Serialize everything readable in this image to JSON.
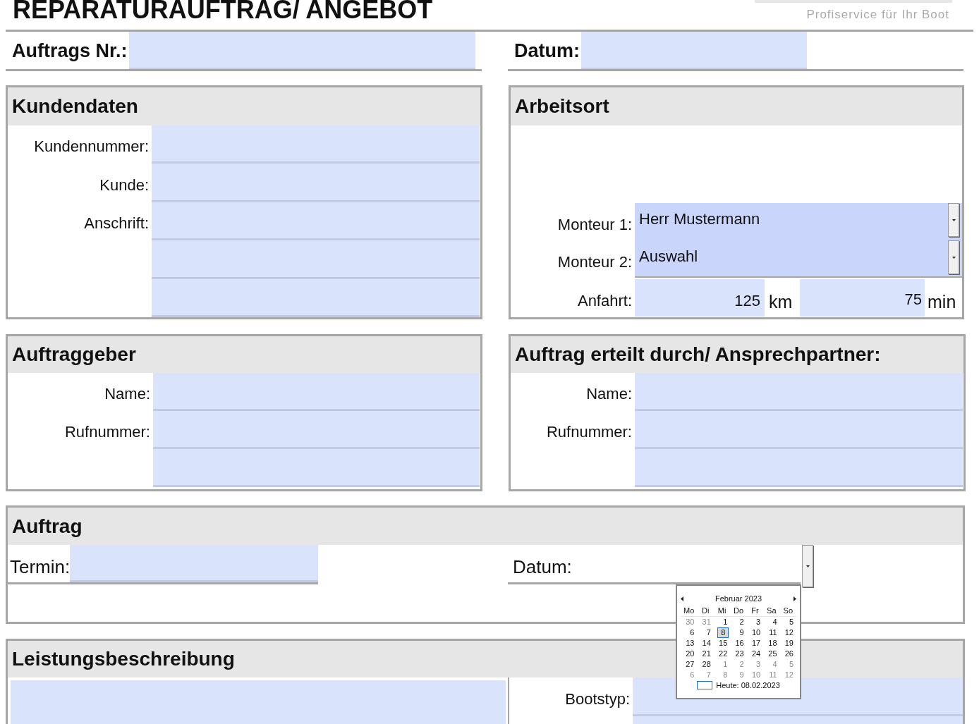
{
  "title": "REPARATURAUFTRAG/ ANGEBOT",
  "logo": {
    "tagline": "Profiservice für Ihr Boot"
  },
  "header_fields": [
    {
      "label": "Auftrags Nr.:"
    },
    {
      "label": "Datum:"
    }
  ],
  "kundendaten": {
    "title": "Kundendaten",
    "rows": [
      {
        "kind": "field",
        "label": "Kundennummer:"
      },
      {
        "kind": "field",
        "label": "Kunde:"
      },
      {
        "kind": "field",
        "label": "Anschrift:"
      },
      {
        "kind": "field"
      },
      {
        "kind": "field"
      }
    ]
  },
  "arbeitsort": {
    "title": "Arbeitsort",
    "rows": [
      {
        "kind": "dropdown",
        "label": "Monteur 1:",
        "value": "Herr Mustermann"
      },
      {
        "kind": "dropdown",
        "label": "Monteur 2:",
        "value": "Auswahl"
      },
      {
        "kind": "distance",
        "label": "Anfahrt:",
        "distance": "125",
        "distance_unit": "km",
        "time": "75",
        "time_unit": "min"
      }
    ]
  },
  "auftraggeber": {
    "title": "Auftraggeber",
    "rows": [
      {
        "kind": "field",
        "label": "Name:"
      },
      {
        "kind": "field",
        "label": "Rufnummer:"
      },
      {
        "kind": "field"
      }
    ]
  },
  "ansprechpartner": {
    "title": "Auftrag erteilt durch/ Ansprechpartner:",
    "rows": [
      {
        "kind": "field",
        "label": "Name:"
      },
      {
        "kind": "field",
        "label": "Rufnummer:"
      },
      {
        "kind": "field"
      }
    ]
  },
  "auftrag": {
    "title": "Auftrag",
    "termin_label": "Termin:",
    "datum_label": "Datum:"
  },
  "calendar": {
    "month": "Februar 2023",
    "weekdays": [
      "Mo",
      "Di",
      "Mi",
      "Do",
      "Fr",
      "Sa",
      "So"
    ],
    "weeks": [
      [
        {
          "day": "30",
          "other_month": true,
          "selected": false
        },
        {
          "day": "31",
          "other_month": true,
          "selected": false
        },
        {
          "day": "1",
          "other_month": false,
          "selected": false
        },
        {
          "day": "2",
          "other_month": false,
          "selected": false
        },
        {
          "day": "3",
          "other_month": false,
          "selected": false
        },
        {
          "day": "4",
          "other_month": false,
          "selected": false
        },
        {
          "day": "5",
          "other_month": false,
          "selected": false
        }
      ],
      [
        {
          "day": "6",
          "other_month": false,
          "selected": false
        },
        {
          "day": "7",
          "other_month": false,
          "selected": false
        },
        {
          "day": "8",
          "other_month": false,
          "selected": true
        },
        {
          "day": "9",
          "other_month": false,
          "selected": false
        },
        {
          "day": "10",
          "other_month": false,
          "selected": false
        },
        {
          "day": "11",
          "other_month": false,
          "selected": false
        },
        {
          "day": "12",
          "other_month": false,
          "selected": false
        }
      ],
      [
        {
          "day": "13",
          "other_month": false,
          "selected": false
        },
        {
          "day": "14",
          "other_month": false,
          "selected": false
        },
        {
          "day": "15",
          "other_month": false,
          "selected": false
        },
        {
          "day": "16",
          "other_month": false,
          "selected": false
        },
        {
          "day": "17",
          "other_month": false,
          "selected": false
        },
        {
          "day": "18",
          "other_month": false,
          "selected": false
        },
        {
          "day": "19",
          "other_month": false,
          "selected": false
        }
      ],
      [
        {
          "day": "20",
          "other_month": false,
          "selected": false
        },
        {
          "day": "21",
          "other_month": false,
          "selected": false
        },
        {
          "day": "22",
          "other_month": false,
          "selected": false
        },
        {
          "day": "23",
          "other_month": false,
          "selected": false
        },
        {
          "day": "24",
          "other_month": false,
          "selected": false
        },
        {
          "day": "25",
          "other_month": false,
          "selected": false
        },
        {
          "day": "26",
          "other_month": false,
          "selected": false
        }
      ],
      [
        {
          "day": "27",
          "other_month": false,
          "selected": false
        },
        {
          "day": "28",
          "other_month": false,
          "selected": false
        },
        {
          "day": "1",
          "other_month": true,
          "selected": false
        },
        {
          "day": "2",
          "other_month": true,
          "selected": false
        },
        {
          "day": "3",
          "other_month": true,
          "selected": false
        },
        {
          "day": "4",
          "other_month": true,
          "selected": false
        },
        {
          "day": "5",
          "other_month": true,
          "selected": false
        }
      ],
      [
        {
          "day": "6",
          "other_month": true,
          "selected": false
        },
        {
          "day": "7",
          "other_month": true,
          "selected": false
        },
        {
          "day": "8",
          "other_month": true,
          "selected": false
        },
        {
          "day": "9",
          "other_month": true,
          "selected": false
        },
        {
          "day": "10",
          "other_month": true,
          "selected": false
        },
        {
          "day": "11",
          "other_month": true,
          "selected": false
        },
        {
          "day": "12",
          "other_month": true,
          "selected": false
        }
      ]
    ],
    "today_label": "Heute: 08.02.2023"
  },
  "leistungsbeschreibung": {
    "title": "Leistungsbeschreibung",
    "bootstyp_label": "Bootstyp:"
  }
}
